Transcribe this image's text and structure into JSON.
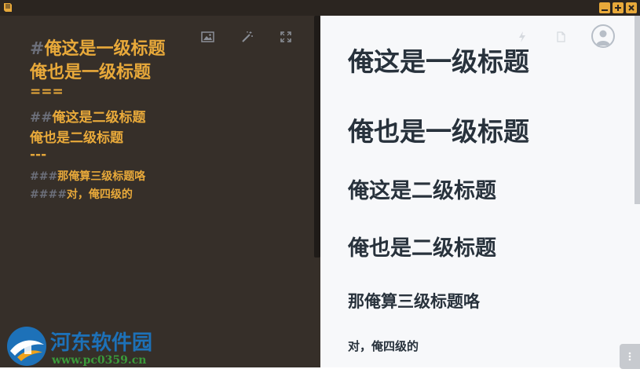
{
  "editor": {
    "lines": [
      {
        "marker": "#",
        "text": "俺这是一级标题"
      },
      {
        "marker": "",
        "text": "俺也是一级标题"
      },
      {
        "marker": "",
        "text": "==="
      },
      {
        "marker": "##",
        "text": "俺这是二级标题"
      },
      {
        "marker": "",
        "text": "俺也是二级标题"
      },
      {
        "marker": "",
        "text": "---"
      },
      {
        "marker": "###",
        "text": "那俺算三级标题咯"
      },
      {
        "marker": "####",
        "text": "对，俺四级的"
      }
    ]
  },
  "preview": {
    "headings": [
      {
        "level": 1,
        "text": "俺这是一级标题"
      },
      {
        "level": 1,
        "text": "俺也是一级标题"
      },
      {
        "level": 2,
        "text": "俺这是二级标题"
      },
      {
        "level": 2,
        "text": "俺也是二级标题"
      },
      {
        "level": 3,
        "text": "那俺算三级标题咯"
      },
      {
        "level": 4,
        "text": "对，俺四级的"
      }
    ]
  },
  "watermark": {
    "title": "河东软件园",
    "url": "www.pc0359.cn"
  },
  "colors": {
    "accent": "#e8a93a",
    "editor_bg": "#362f29",
    "titlebar_bg": "#2b2520",
    "preview_bg": "#f7f8fa",
    "heading_text": "#28323c",
    "markup_marker": "#6c6f7a"
  },
  "icons": {
    "app": "book-icon",
    "toolbar": [
      "image-icon",
      "magic-wand-icon",
      "fullscreen-icon",
      "lightning-icon",
      "file-icon"
    ],
    "window": [
      "minimize-icon",
      "maximize-icon",
      "close-icon"
    ],
    "account": "user-avatar-icon"
  }
}
